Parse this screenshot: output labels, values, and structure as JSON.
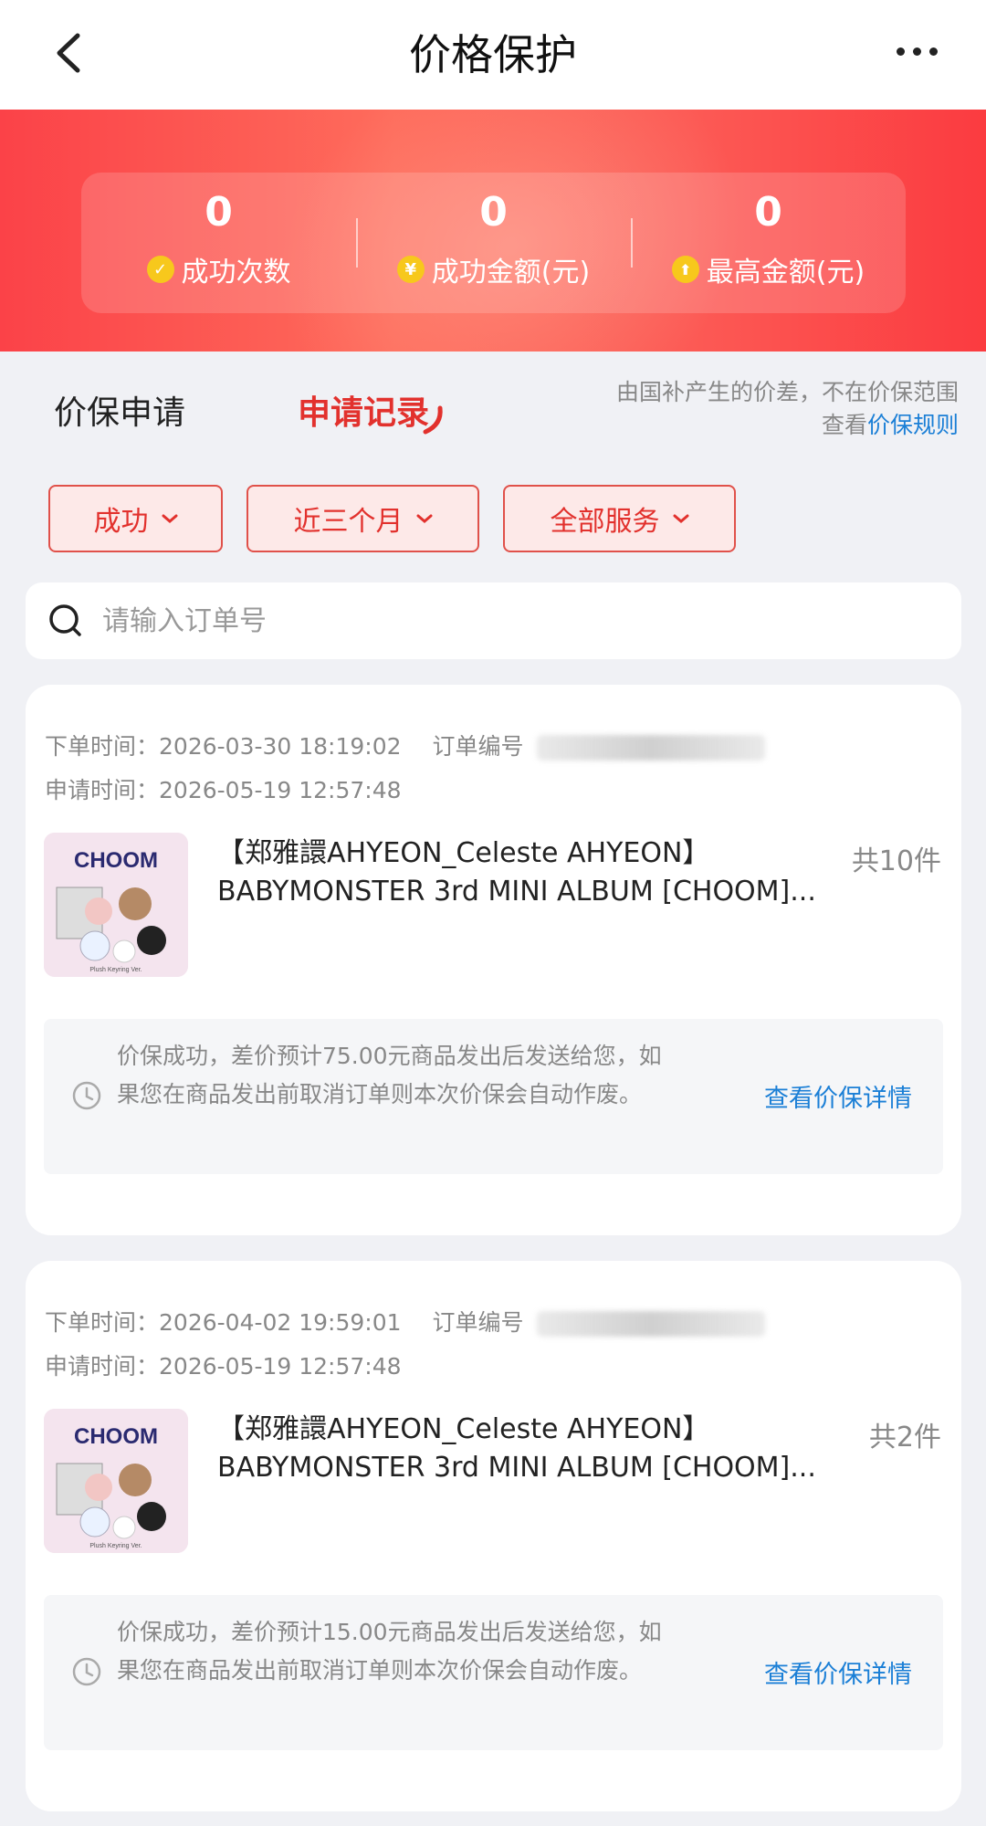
{
  "header": {
    "title": "价格保护"
  },
  "stats": [
    {
      "value": "0",
      "label": "成功次数",
      "icon": "check-coin-icon",
      "glyph": "✓"
    },
    {
      "value": "0",
      "label": "成功金额(元)",
      "icon": "yen-coin-icon",
      "glyph": "¥"
    },
    {
      "value": "0",
      "label": "最高金额(元)",
      "icon": "up-arrow-coin-icon",
      "glyph": "⬆"
    }
  ],
  "tabs": {
    "apply": "价保申请",
    "records": "申请记录"
  },
  "notice": {
    "line1": "由国补产生的价差，不在价保范围",
    "prefix": "查看",
    "link": "价保规则"
  },
  "filters": [
    {
      "label": "成功"
    },
    {
      "label": "近三个月"
    },
    {
      "label": "全部服务"
    }
  ],
  "search": {
    "placeholder": "请输入订单号"
  },
  "orders": [
    {
      "order_time_label": "下单时间：",
      "order_time": "2026-03-30 18:19:02",
      "order_no_label": "订单编号",
      "apply_time_label": "申请时间：",
      "apply_time": "2026-05-19 12:57:48",
      "name_line1": "【郑雅譞AHYEON_Celeste AHYEON】",
      "name_line2": "BABYMONSTER 3rd MINI ALBUM [CHOOM]...",
      "qty": "共10件",
      "status_text": "价保成功，差价预计75.00元商品发出后发送给您，如果您在商品发出前取消订单则本次价保会自动作废。",
      "detail_link": "查看价保详情",
      "thumb": {
        "brand": "CHOOM",
        "caption": "Plush Keyring Ver."
      }
    },
    {
      "order_time_label": "下单时间：",
      "order_time": "2026-04-02 19:59:01",
      "order_no_label": "订单编号",
      "apply_time_label": "申请时间：",
      "apply_time": "2026-05-19 12:57:48",
      "name_line1": "【郑雅譞AHYEON_Celeste AHYEON】",
      "name_line2": "BABYMONSTER 3rd MINI ALBUM [CHOOM]...",
      "qty": "共2件",
      "status_text": "价保成功，差价预计15.00元商品发出后发送给您，如果您在商品发出前取消订单则本次价保会自动作废。",
      "detail_link": "查看价保详情",
      "thumb": {
        "brand": "CHOOM",
        "caption": "Plush Keyring Ver."
      }
    }
  ],
  "colors": {
    "brand_red": "#e2312d",
    "link_blue": "#1b7fd6",
    "coin_yellow": "#f7c81c"
  }
}
